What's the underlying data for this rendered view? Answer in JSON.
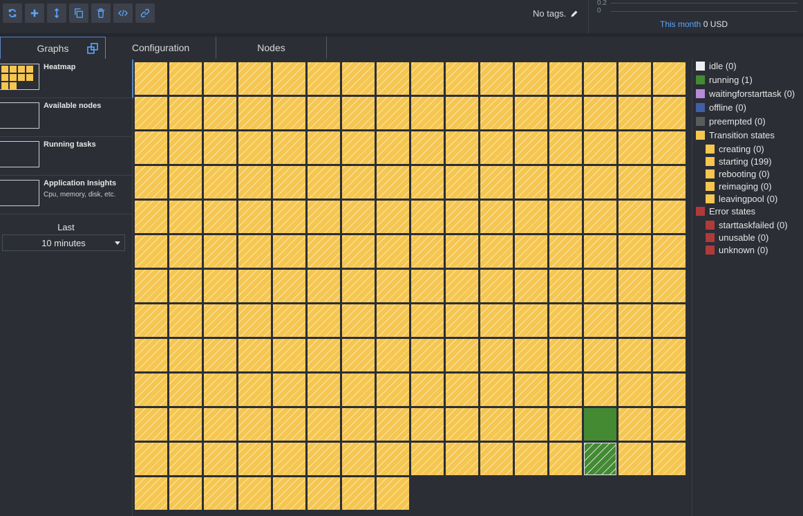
{
  "toolbar": {
    "buttons": [
      {
        "name": "refresh-button",
        "icon": "refresh-icon"
      },
      {
        "name": "add-button",
        "icon": "plus-icon"
      },
      {
        "name": "resize-button",
        "icon": "resize-icon"
      },
      {
        "name": "clone-button",
        "icon": "copy-icon"
      },
      {
        "name": "delete-button",
        "icon": "trash-icon"
      },
      {
        "name": "code-button",
        "icon": "code-icon"
      },
      {
        "name": "link-button",
        "icon": "link-icon"
      }
    ]
  },
  "tags": {
    "text": "No tags."
  },
  "cost": {
    "tick_top": "0.2",
    "tick_bottom": "0",
    "period_link": "This month",
    "amount": "0 USD"
  },
  "tabs": [
    {
      "label": "Graphs",
      "active": true
    },
    {
      "label": "Configuration",
      "active": false
    },
    {
      "label": "Nodes",
      "active": false
    }
  ],
  "graphs": [
    {
      "title": "Heatmap",
      "subtitle": "",
      "active": true
    },
    {
      "title": "Available nodes",
      "subtitle": "",
      "active": false
    },
    {
      "title": "Running tasks",
      "subtitle": "",
      "active": false
    },
    {
      "title": "Application Insights",
      "subtitle": "Cpu, memory, disk, etc.",
      "active": false
    }
  ],
  "time_range": {
    "label": "Last",
    "selected": "10 minutes"
  },
  "heatmap": {
    "columns": 16,
    "total_nodes": 200,
    "cells": {
      "default_state": "starting",
      "special": [
        {
          "index": 173,
          "state": "running"
        },
        {
          "index": 189,
          "state": "running-starting"
        }
      ]
    }
  },
  "legend": [
    {
      "label": "idle (0)",
      "color": "#eceef3",
      "indent": false
    },
    {
      "label": "running (1)",
      "color": "#438a33",
      "indent": false
    },
    {
      "label": "waitingforstarttask (0)",
      "color": "#b58ad6",
      "indent": false
    },
    {
      "label": "offline (0)",
      "color": "#3f5fa6",
      "indent": false
    },
    {
      "label": "preempted (0)",
      "color": "#5b5b5b",
      "indent": false
    },
    {
      "label": "Transition states",
      "color": "#f5c650",
      "indent": false
    },
    {
      "label": "creating (0)",
      "color": "#f5c650",
      "indent": true
    },
    {
      "label": "starting (199)",
      "color": "#f5c650",
      "indent": true
    },
    {
      "label": "rebooting (0)",
      "color": "#f5c650",
      "indent": true
    },
    {
      "label": "reimaging (0)",
      "color": "#f5c650",
      "indent": true
    },
    {
      "label": "leavingpool (0)",
      "color": "#f5c650",
      "indent": true
    },
    {
      "label": "Error states",
      "color": "#b03a3a",
      "indent": false
    },
    {
      "label": "starttaskfailed (0)",
      "color": "#b03a3a",
      "indent": true
    },
    {
      "label": "unusable (0)",
      "color": "#b03a3a",
      "indent": true
    },
    {
      "label": "unknown (0)",
      "color": "#b03a3a",
      "indent": true
    }
  ]
}
